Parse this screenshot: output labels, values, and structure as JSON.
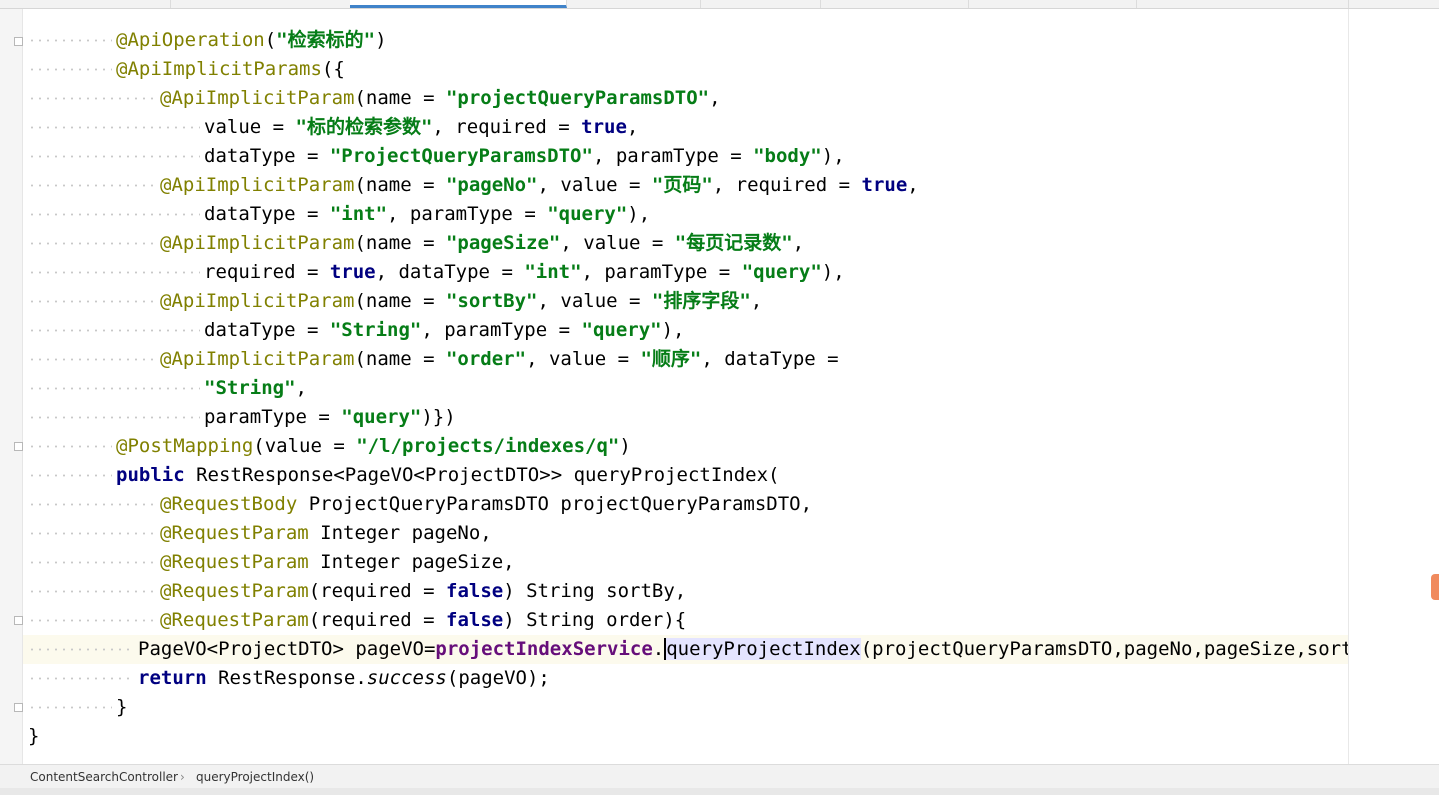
{
  "editor": {
    "lines": [
      {
        "indent": 1,
        "tokens": [
          {
            "t": "@ApiOperation",
            "c": "ann"
          },
          {
            "t": "(",
            "c": ""
          },
          {
            "t": "\"检索标的\"",
            "c": "str"
          },
          {
            "t": ")",
            "c": ""
          }
        ]
      },
      {
        "indent": 1,
        "tokens": [
          {
            "t": "@ApiImplicitParams",
            "c": "ann"
          },
          {
            "t": "({",
            "c": ""
          }
        ]
      },
      {
        "indent": 2,
        "tokens": [
          {
            "t": "@ApiImplicitParam",
            "c": "ann"
          },
          {
            "t": "(name = ",
            "c": ""
          },
          {
            "t": "\"projectQueryParamsDTO\"",
            "c": "str"
          },
          {
            "t": ",",
            "c": ""
          }
        ]
      },
      {
        "indent": 3,
        "tokens": [
          {
            "t": "value = ",
            "c": ""
          },
          {
            "t": "\"标的检索参数\"",
            "c": "str"
          },
          {
            "t": ", required = ",
            "c": ""
          },
          {
            "t": "true",
            "c": "kw"
          },
          {
            "t": ",",
            "c": ""
          }
        ]
      },
      {
        "indent": 3,
        "tokens": [
          {
            "t": "dataType = ",
            "c": ""
          },
          {
            "t": "\"ProjectQueryParamsDTO\"",
            "c": "str"
          },
          {
            "t": ", paramType = ",
            "c": ""
          },
          {
            "t": "\"body\"",
            "c": "str"
          },
          {
            "t": "),",
            "c": ""
          }
        ]
      },
      {
        "indent": 2,
        "tokens": [
          {
            "t": "@ApiImplicitParam",
            "c": "ann"
          },
          {
            "t": "(name = ",
            "c": ""
          },
          {
            "t": "\"pageNo\"",
            "c": "str"
          },
          {
            "t": ", value = ",
            "c": ""
          },
          {
            "t": "\"页码\"",
            "c": "str"
          },
          {
            "t": ", required = ",
            "c": ""
          },
          {
            "t": "true",
            "c": "kw"
          },
          {
            "t": ",",
            "c": ""
          }
        ]
      },
      {
        "indent": 3,
        "tokens": [
          {
            "t": "dataType = ",
            "c": ""
          },
          {
            "t": "\"int\"",
            "c": "str"
          },
          {
            "t": ", paramType = ",
            "c": ""
          },
          {
            "t": "\"query\"",
            "c": "str"
          },
          {
            "t": "),",
            "c": ""
          }
        ]
      },
      {
        "indent": 2,
        "tokens": [
          {
            "t": "@ApiImplicitParam",
            "c": "ann"
          },
          {
            "t": "(name = ",
            "c": ""
          },
          {
            "t": "\"pageSize\"",
            "c": "str"
          },
          {
            "t": ", value = ",
            "c": ""
          },
          {
            "t": "\"每页记录数\"",
            "c": "str"
          },
          {
            "t": ",",
            "c": ""
          }
        ]
      },
      {
        "indent": 3,
        "tokens": [
          {
            "t": "required = ",
            "c": ""
          },
          {
            "t": "true",
            "c": "kw"
          },
          {
            "t": ", dataType = ",
            "c": ""
          },
          {
            "t": "\"int\"",
            "c": "str"
          },
          {
            "t": ", paramType = ",
            "c": ""
          },
          {
            "t": "\"query\"",
            "c": "str"
          },
          {
            "t": "),",
            "c": ""
          }
        ]
      },
      {
        "indent": 2,
        "tokens": [
          {
            "t": "@ApiImplicitParam",
            "c": "ann"
          },
          {
            "t": "(name = ",
            "c": ""
          },
          {
            "t": "\"sortBy\"",
            "c": "str"
          },
          {
            "t": ", value = ",
            "c": ""
          },
          {
            "t": "\"排序字段\"",
            "c": "str"
          },
          {
            "t": ",",
            "c": ""
          }
        ]
      },
      {
        "indent": 3,
        "tokens": [
          {
            "t": "dataType = ",
            "c": ""
          },
          {
            "t": "\"String\"",
            "c": "str"
          },
          {
            "t": ", paramType = ",
            "c": ""
          },
          {
            "t": "\"query\"",
            "c": "str"
          },
          {
            "t": "),",
            "c": ""
          }
        ]
      },
      {
        "indent": 2,
        "tokens": [
          {
            "t": "@ApiImplicitParam",
            "c": "ann"
          },
          {
            "t": "(name = ",
            "c": ""
          },
          {
            "t": "\"order\"",
            "c": "str"
          },
          {
            "t": ", value = ",
            "c": ""
          },
          {
            "t": "\"顺序\"",
            "c": "str"
          },
          {
            "t": ", dataType =",
            "c": ""
          }
        ]
      },
      {
        "indent": 3,
        "tokens": [
          {
            "t": "\"String\"",
            "c": "str"
          },
          {
            "t": ",",
            "c": ""
          }
        ]
      },
      {
        "indent": 3,
        "tokens": [
          {
            "t": "paramType = ",
            "c": ""
          },
          {
            "t": "\"query\"",
            "c": "str"
          },
          {
            "t": ")})",
            "c": ""
          }
        ]
      },
      {
        "indent": 1,
        "tokens": [
          {
            "t": "@PostMapping",
            "c": "ann"
          },
          {
            "t": "(value = ",
            "c": ""
          },
          {
            "t": "\"/l/projects/indexes/q\"",
            "c": "str"
          },
          {
            "t": ")",
            "c": ""
          }
        ]
      },
      {
        "indent": 1,
        "tokens": [
          {
            "t": "public",
            "c": "kw"
          },
          {
            "t": " RestResponse<PageVO<ProjectDTO>> queryProjectIndex(",
            "c": ""
          }
        ]
      },
      {
        "indent": 2,
        "tokens": [
          {
            "t": "@RequestBody",
            "c": "ann"
          },
          {
            "t": " ProjectQueryParamsDTO projectQueryParamsDTO,",
            "c": ""
          }
        ]
      },
      {
        "indent": 2,
        "tokens": [
          {
            "t": "@RequestParam",
            "c": "ann"
          },
          {
            "t": " Integer pageNo,",
            "c": ""
          }
        ]
      },
      {
        "indent": 2,
        "tokens": [
          {
            "t": "@RequestParam",
            "c": "ann"
          },
          {
            "t": " Integer pageSize,",
            "c": ""
          }
        ]
      },
      {
        "indent": 2,
        "tokens": [
          {
            "t": "@RequestParam",
            "c": "ann"
          },
          {
            "t": "(required = ",
            "c": ""
          },
          {
            "t": "false",
            "c": "kw"
          },
          {
            "t": ") String sortBy,",
            "c": ""
          }
        ]
      },
      {
        "indent": 2,
        "tokens": [
          {
            "t": "@RequestParam",
            "c": "ann"
          },
          {
            "t": "(required = ",
            "c": ""
          },
          {
            "t": "false",
            "c": "kw"
          },
          {
            "t": ") String order){",
            "c": ""
          }
        ]
      },
      {
        "indent": 1.5,
        "current": true,
        "tokens": [
          {
            "t": "PageVO<ProjectDTO> pageVO=",
            "c": ""
          },
          {
            "t": "projectIndexService",
            "c": "fld"
          },
          {
            "t": ".",
            "c": ""
          },
          {
            "t": "queryProjectIndex",
            "c": "hl caret"
          },
          {
            "t": "(projectQueryParamsDTO,pageNo,pageSize,sortBy,order);",
            "c": ""
          }
        ]
      },
      {
        "indent": 1.5,
        "tokens": [
          {
            "t": "return",
            "c": "kw"
          },
          {
            "t": " RestResponse.",
            "c": ""
          },
          {
            "t": "success",
            "c": "ital"
          },
          {
            "t": "(pageVO);",
            "c": ""
          }
        ]
      },
      {
        "indent": 1,
        "tokens": [
          {
            "t": "}",
            "c": ""
          }
        ]
      },
      {
        "indent": 0,
        "tokens": [
          {
            "t": "}",
            "c": ""
          }
        ]
      }
    ]
  },
  "breadcrumb": {
    "class_name": "ContentSearchController",
    "method_name": "queryProjectIndex()"
  }
}
